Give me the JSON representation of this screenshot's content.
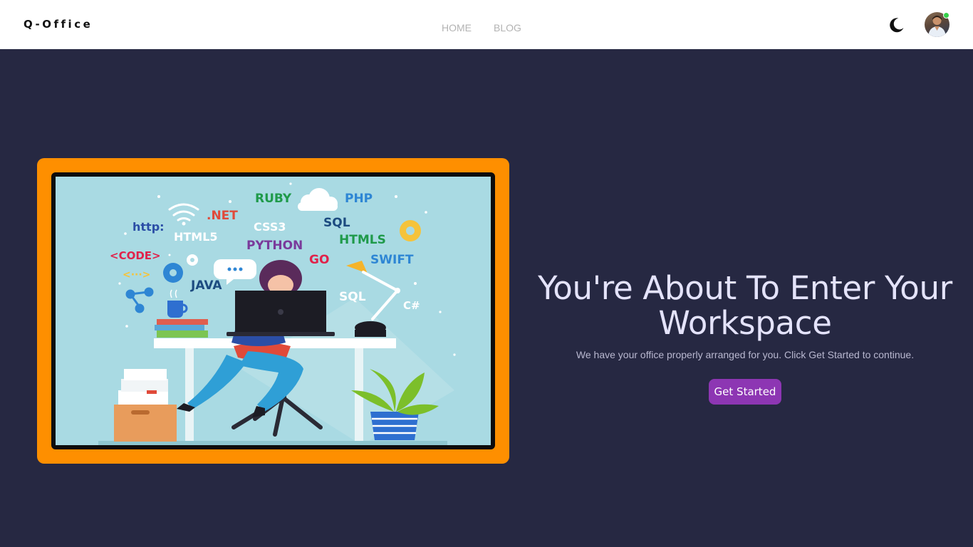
{
  "header": {
    "brand": "Q-Office",
    "nav": [
      {
        "label": "HOME"
      },
      {
        "label": "BLOG"
      }
    ],
    "theme_toggle_icon": "moon-icon",
    "avatar_status_color": "#35d04a"
  },
  "illustration": {
    "frame_color": "#fe8f00",
    "background_color": "#a9dae3",
    "tags": {
      "ruby": "RUBY",
      "php": "PHP",
      "net": ".NET",
      "http": "http:",
      "html5": "HTML5",
      "css3": "CSS3",
      "sql1": "SQL",
      "htmls": "HTMLS",
      "code": "<CODE>",
      "python": "PYTHON",
      "go": "GO",
      "swift": "SWIFT",
      "arrows": "<···>",
      "java": "JAVA",
      "sql2": "SQL",
      "csharp": "C#"
    }
  },
  "hero": {
    "title": "You're About To Enter Your Workspace",
    "subtitle": "We have your office properly arranged for you. Click Get Started to continue.",
    "cta_label": "Get Started",
    "title_color": "#e4e3fb",
    "cta_color": "#8d36b3"
  },
  "theme": {
    "background": "#262842"
  }
}
